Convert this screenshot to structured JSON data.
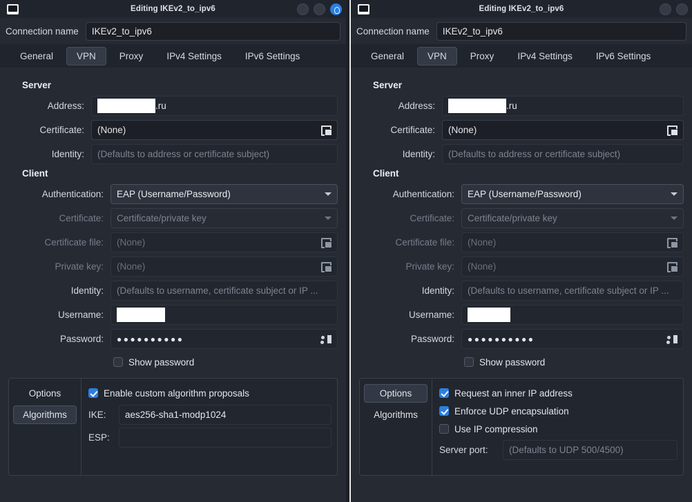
{
  "windows": [
    {
      "id": "left",
      "titlebar": {
        "icon": "network-card-icon",
        "title": "Editing IKEv2_to_ipv6",
        "buttons": [
          {
            "name": "minimize-button",
            "style": "plain"
          },
          {
            "name": "maximize-button",
            "style": "plain"
          },
          {
            "name": "close-button",
            "style": "accent"
          }
        ]
      },
      "connection": {
        "label": "Connection name",
        "value": "IKEv2_to_ipv6"
      },
      "tabs": [
        {
          "label": "General",
          "active": false
        },
        {
          "label": "VPN",
          "active": true
        },
        {
          "label": "Proxy",
          "active": false
        },
        {
          "label": "IPv4 Settings",
          "active": false
        },
        {
          "label": "IPv6 Settings",
          "active": false
        }
      ],
      "server": {
        "heading": "Server",
        "address": {
          "label": "Address:",
          "redacted": true,
          "suffix": ".ru"
        },
        "certificate": {
          "label": "Certificate:",
          "value": "(None)"
        },
        "identity": {
          "label": "Identity:",
          "placeholder": "(Defaults to address or certificate subject)"
        }
      },
      "client": {
        "heading": "Client",
        "authentication": {
          "label": "Authentication:",
          "value": "EAP (Username/Password)"
        },
        "certificate": {
          "label": "Certificate:",
          "value": "Certificate/private key",
          "disabled": true
        },
        "certificate_file": {
          "label": "Certificate file:",
          "value": "(None)",
          "disabled": true
        },
        "private_key": {
          "label": "Private key:",
          "value": "(None)",
          "disabled": true
        },
        "identity": {
          "label": "Identity:",
          "placeholder": "(Defaults to username, certificate subject or IP ..."
        },
        "username": {
          "label": "Username:",
          "redacted": true
        },
        "password": {
          "label": "Password:",
          "value": "●●●●●●●●●●"
        },
        "show_password": {
          "label": "Show password",
          "checked": false
        }
      },
      "options_panel": {
        "side_buttons": [
          {
            "label": "Options",
            "active": false
          },
          {
            "label": "Algorithms",
            "active": true
          }
        ],
        "pane": "algorithms",
        "enable_custom": {
          "label": "Enable custom algorithm proposals",
          "checked": true
        },
        "ike": {
          "label": "IKE:",
          "value": "aes256-sha1-modp1024"
        },
        "esp": {
          "label": "ESP:",
          "value": ""
        }
      }
    },
    {
      "id": "right",
      "titlebar": {
        "icon": "network-card-icon",
        "title": "Editing IKEv2_to_ipv6",
        "buttons": [
          {
            "name": "minimize-button",
            "style": "plain"
          },
          {
            "name": "maximize-button",
            "style": "plain"
          }
        ]
      },
      "connection": {
        "label": "Connection name",
        "value": "IKEv2_to_ipv6"
      },
      "tabs": [
        {
          "label": "General",
          "active": false
        },
        {
          "label": "VPN",
          "active": true
        },
        {
          "label": "Proxy",
          "active": false
        },
        {
          "label": "IPv4 Settings",
          "active": false
        },
        {
          "label": "IPv6 Settings",
          "active": false
        }
      ],
      "server": {
        "heading": "Server",
        "address": {
          "label": "Address:",
          "redacted": true,
          "suffix": ".ru"
        },
        "certificate": {
          "label": "Certificate:",
          "value": "(None)"
        },
        "identity": {
          "label": "Identity:",
          "placeholder": "(Defaults to address or certificate subject)"
        }
      },
      "client": {
        "heading": "Client",
        "authentication": {
          "label": "Authentication:",
          "value": "EAP (Username/Password)"
        },
        "certificate": {
          "label": "Certificate:",
          "value": "Certificate/private key",
          "disabled": true
        },
        "certificate_file": {
          "label": "Certificate file:",
          "value": "(None)",
          "disabled": true
        },
        "private_key": {
          "label": "Private key:",
          "value": "(None)",
          "disabled": true
        },
        "identity": {
          "label": "Identity:",
          "placeholder": "(Defaults to username, certificate subject or IP ..."
        },
        "username": {
          "label": "Username:",
          "redacted": true
        },
        "password": {
          "label": "Password:",
          "value": "●●●●●●●●●●"
        },
        "show_password": {
          "label": "Show password",
          "checked": false
        }
      },
      "options_panel": {
        "side_buttons": [
          {
            "label": "Options",
            "active": true
          },
          {
            "label": "Algorithms",
            "active": false
          }
        ],
        "pane": "options",
        "request_inner_ip": {
          "label": "Request an inner IP address",
          "checked": true
        },
        "enforce_udp": {
          "label": "Enforce UDP encapsulation",
          "checked": true
        },
        "use_ip_compression": {
          "label": "Use IP compression",
          "checked": false
        },
        "server_port": {
          "label": "Server port:",
          "placeholder": "(Defaults to UDP 500/4500)"
        }
      }
    }
  ],
  "colors": {
    "accent": "#2b7fe0",
    "window_bg": "#262a33",
    "field_bg": "#1c1f26",
    "titlebar_bg": "#20242c",
    "text": "#e4e6eb",
    "muted_text": "#7c8392"
  }
}
